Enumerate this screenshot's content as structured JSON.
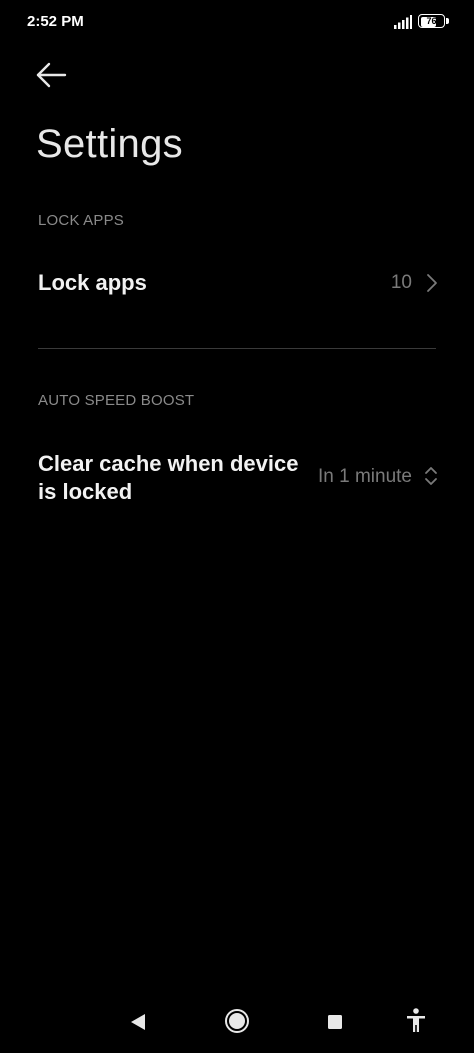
{
  "status_bar": {
    "time": "2:52 PM",
    "battery": "76",
    "battery_level": 0.76
  },
  "header": {
    "title": "Settings"
  },
  "sections": [
    {
      "header": "LOCK APPS",
      "rows": [
        {
          "title": "Lock apps",
          "value": "10",
          "icon": "chevron-right-icon"
        }
      ]
    },
    {
      "header": "AUTO SPEED BOOST",
      "rows": [
        {
          "title": "Clear cache when device is locked",
          "value": "In 1 minute",
          "icon": "chevron-up-down-icon"
        }
      ]
    }
  ],
  "nav_bar": {
    "icons": [
      "back-triangle-icon",
      "home-circle-icon",
      "recents-square-icon",
      "accessibility-icon"
    ]
  },
  "colors": {
    "background": "#000000",
    "title": "#e8e8e8",
    "section_header": "#8a8a8a",
    "row_value": "#7a7a7a",
    "divider": "#3a3a3a"
  }
}
